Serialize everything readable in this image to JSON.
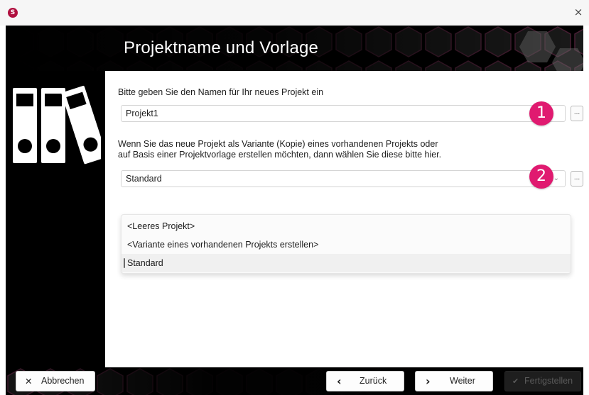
{
  "titlebar": {
    "app_icon_letter": "S",
    "close_glyph": "×"
  },
  "header": {
    "title": "Projektname und Vorlage"
  },
  "project_name": {
    "label": "Bitte geben Sie den Namen für Ihr neues Projekt ein",
    "value": "Projekt1",
    "badge": "1",
    "browse_label": "..."
  },
  "template": {
    "label_line1": "Wenn Sie das neue Projekt als Variante (Kopie) eines vorhandenen Projekts oder",
    "label_line2": "auf Basis einer Projektvorlage erstellen möchten, dann wählen Sie diese bitte hier.",
    "value": "Standard",
    "badge": "2",
    "browse_label": "...",
    "chevron": "⌄",
    "options": [
      "<Leeres Projekt>",
      "<Variante eines vorhandenen Projekts erstellen>",
      "Standard"
    ]
  },
  "footer": {
    "cancel_label": "Abbrechen",
    "cancel_icon": "✕",
    "back_label": "Zurück",
    "back_icon": "‹",
    "next_label": "Weiter",
    "next_icon": "›",
    "finish_label": "Fertigstellen",
    "finish_icon": "✔"
  },
  "colors": {
    "accent_badge": "#e01a70",
    "header_bg": "#000000",
    "hex_tint": "#3a1a2a",
    "content_bg": "#ffffff"
  }
}
